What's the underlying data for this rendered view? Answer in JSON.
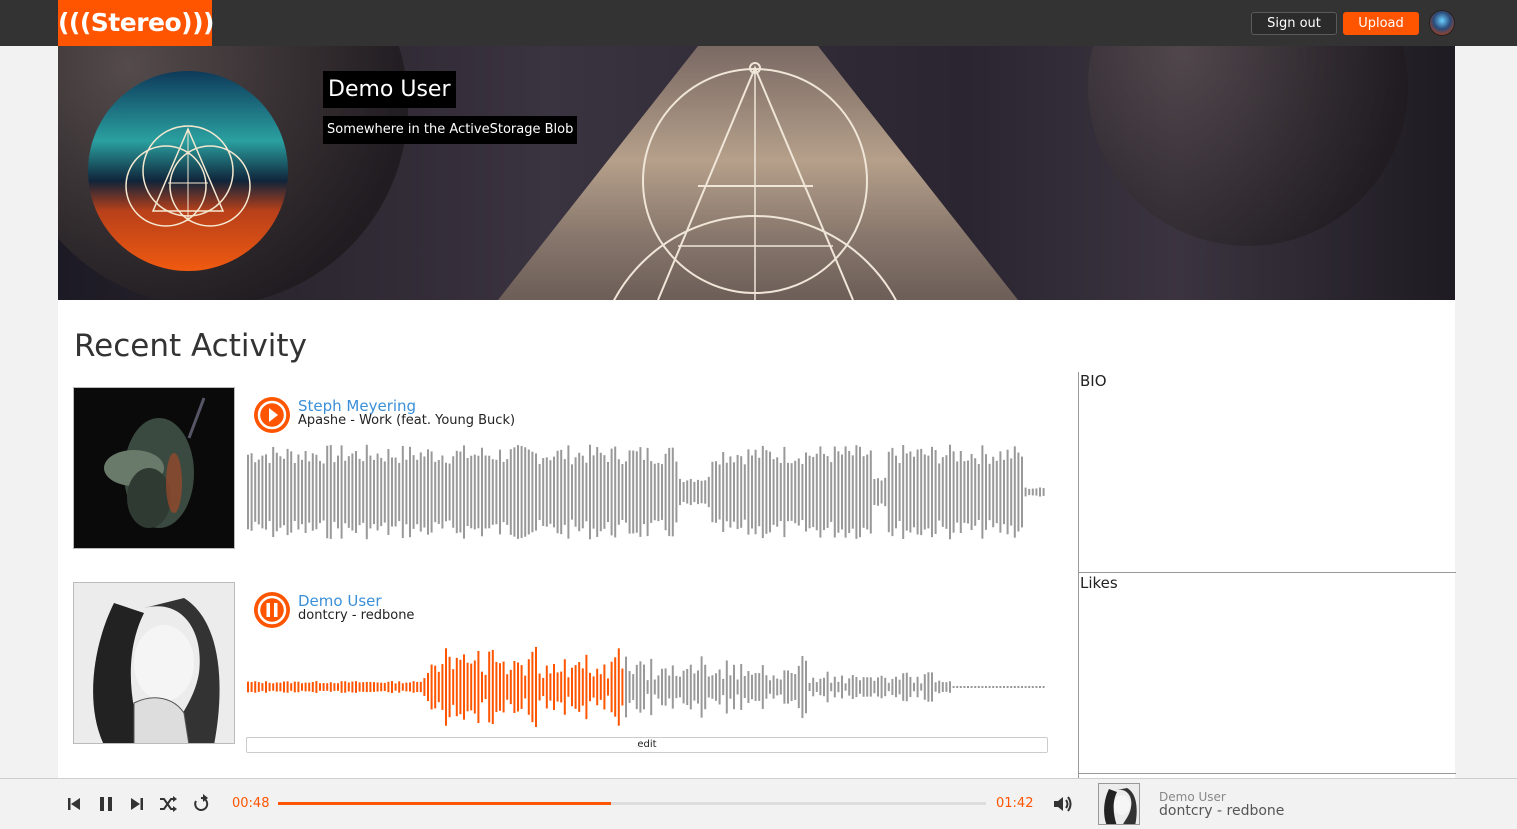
{
  "header": {
    "logo": "(((Stereo)))",
    "sign_out": "Sign out",
    "upload": "Upload"
  },
  "profile": {
    "name": "Demo User",
    "location": "Somewhere in the ActiveStorage Blob"
  },
  "main": {
    "section_title": "Recent Activity",
    "tracks": [
      {
        "uploader": "Steph Meyering",
        "title": "Apashe - Work (feat. Young Buck)",
        "state": "paused",
        "progress": 0
      },
      {
        "uploader": "Demo User",
        "title": "dontcry - redbone",
        "state": "playing",
        "progress": 0.47,
        "edit_label": "edit"
      }
    ]
  },
  "sidebar": {
    "bio_label": "BIO",
    "likes_label": "Likes"
  },
  "player": {
    "elapsed": "00:48",
    "duration": "01:42",
    "progress": 0.47,
    "now_playing_user": "Demo User",
    "now_playing_title": "dontcry - redbone"
  },
  "colors": {
    "accent": "#ff5500",
    "link": "#3a8fd8",
    "header_bg": "#333333",
    "wave_idle": "#999999"
  }
}
